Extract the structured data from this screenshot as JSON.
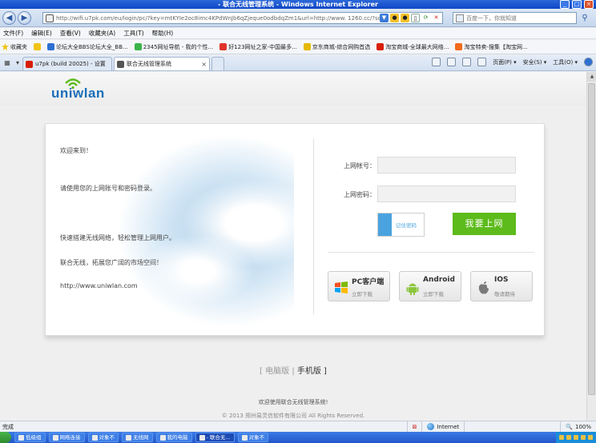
{
  "browser": {
    "title": "- 联合无线管理系统 - Windows Internet Explorer",
    "address": "http://wifi.u7pk.com/eu/login/pc/?key=mtKYIe2oc8imc4KPdWnJb6qZjeque0odbdqZm1&url=http://www. 1260.cc/?scj",
    "search_placeholder": "百度一下，你就知道",
    "menu": [
      "文件(F)",
      "编辑(E)",
      "查看(V)",
      "收藏夹(A)",
      "工具(T)",
      "帮助(H)"
    ],
    "favorites_label": "收藏夹",
    "favorites": [
      {
        "label": "论坛大全BBS论坛大全_BB...",
        "color": "#2d6fd1"
      },
      {
        "label": "2345网址导航 - 我的个性...",
        "color": "#3cb44b"
      },
      {
        "label": "好123网址之家-中国最多...",
        "color": "#e0332a"
      },
      {
        "label": "京东商城-综合网购首选",
        "color": "#e6b800"
      },
      {
        "label": "淘宝商城-全球最大网络...",
        "color": "#d81e06"
      },
      {
        "label": "淘宝特卖-搜集【淘宝网...",
        "color": "#f26a1b"
      }
    ],
    "tabs": [
      {
        "label": "u7pk (build 20025) - 设置",
        "color": "#d81e06"
      },
      {
        "label": "联合无线管理系统",
        "color": "#555555"
      }
    ],
    "tab_tools": [
      "页面(P) ▾",
      "安全(S) ▾",
      "工具(O) ▾"
    ],
    "status_text": "完成",
    "zone": "Internet",
    "zoom": "100%"
  },
  "page": {
    "brand": "uniwlan",
    "welcome": "欢迎来到！",
    "instruction": "请使用您的上网账号和密码登录。",
    "promo1": "快速搭建无线网络，轻松管理上网用户。",
    "promo2": "联合无线，拓展您广阔的市场空间！",
    "website": "http://www.uniwlan.com",
    "account_label": "上网帐号：",
    "password_label": "上网密码：",
    "account_value": "",
    "password_value": "",
    "remember_label": "记住密码",
    "login_label": "我要上网",
    "downloads": [
      {
        "title": "PC客户端",
        "sub": "立即下载",
        "icon": "windows-logo-icon"
      },
      {
        "title": "Android",
        "sub": "立即下载",
        "icon": "android-robot-icon"
      },
      {
        "title": "IOS",
        "sub": "敬请期待",
        "icon": "apple-logo-icon"
      }
    ],
    "version_left": "[ 电脑版",
    "version_sep": "|",
    "version_right": "手机版 ]",
    "footer_welcome": "欢迎使用联合无线管理系统!",
    "copyright": "© 2013 郑州易灵信软件有限公司 All Rights Reserved."
  },
  "taskbar": {
    "items": [
      "低级组",
      "网络连接",
      "对象不",
      "无线网",
      "我的电脑",
      "- 联合无...",
      "对象不"
    ],
    "active_index": 5
  },
  "colors": {
    "accent_green": "#5dbb1c",
    "accent_blue": "#4aa3df",
    "brand_blue": "#1a6eb8"
  }
}
